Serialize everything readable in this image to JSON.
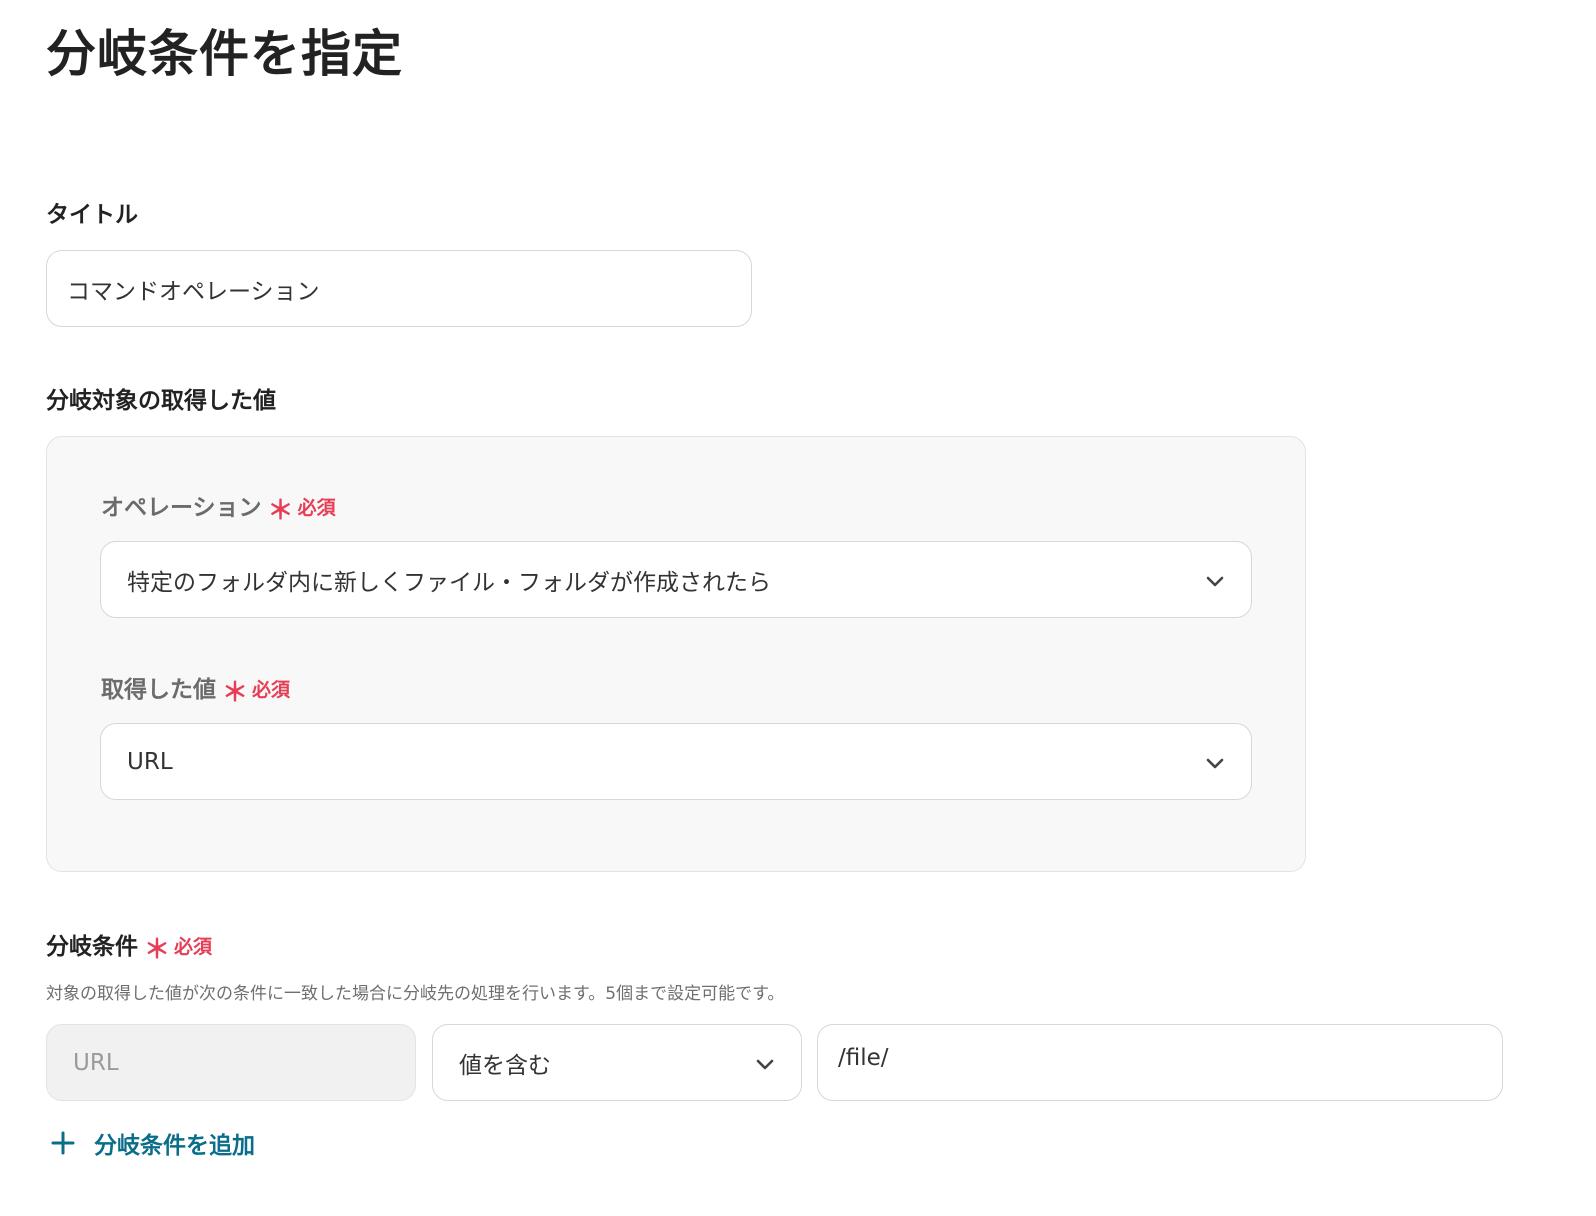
{
  "page": {
    "title": "分岐条件を指定"
  },
  "title_section": {
    "label": "タイトル",
    "value": "コマンドオペレーション"
  },
  "target_section": {
    "label": "分岐対象の取得した値",
    "operation": {
      "label": "オペレーション",
      "required_mark": "＊",
      "required_text": "必須",
      "selected": "特定のフォルダ内に新しくファイル・フォルダが作成されたら",
      "icon": "chevron-down-icon"
    },
    "value_field": {
      "label": "取得した値",
      "required_mark": "＊",
      "required_text": "必須",
      "selected": "URL",
      "icon": "chevron-down-icon"
    }
  },
  "condition_section": {
    "label": "分岐条件",
    "required_mark": "＊",
    "required_text": "必須",
    "helper": "対象の取得した値が次の条件に一致した場合に分岐先の処理を行います。5個まで設定可能です。",
    "rows": [
      {
        "field": "URL",
        "operator": "値を含む",
        "value": "/file/"
      }
    ],
    "add_label": "分岐条件を追加",
    "add_icon": "plus-icon"
  },
  "colors": {
    "required": "#e63e55",
    "link": "#0a6e8a",
    "panel_bg": "#f8f8f8",
    "disabled_bg": "#f1f1f1",
    "border": "#d7d7d7"
  }
}
